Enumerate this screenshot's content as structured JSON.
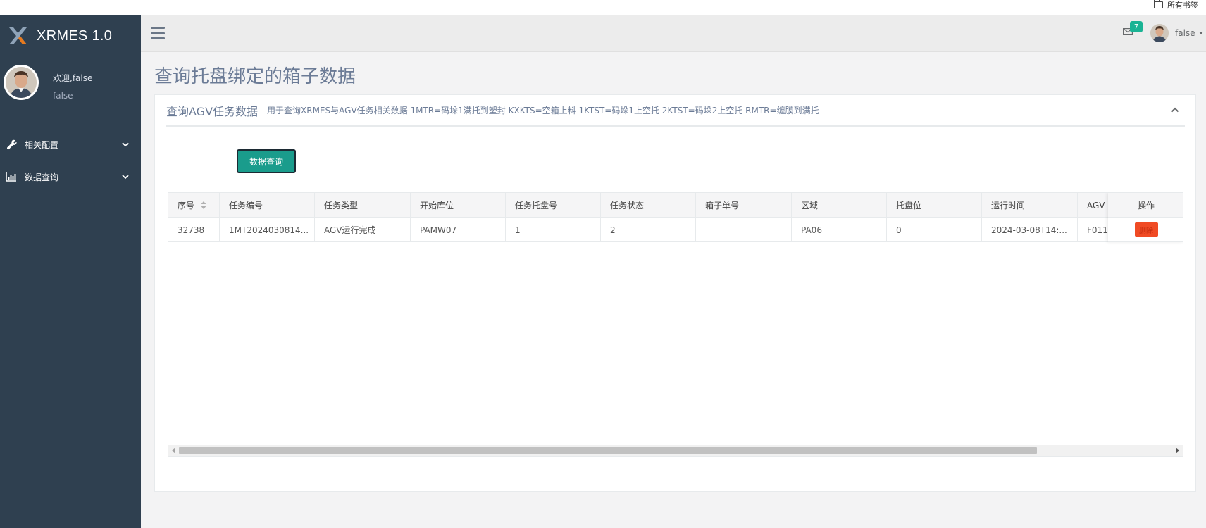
{
  "browser": {
    "bookmarks_all": "所有书签"
  },
  "brand": {
    "name": "XRMES 1.0"
  },
  "profile": {
    "welcome": "欢迎,false",
    "role": "false"
  },
  "sidebar": {
    "items": [
      {
        "label": "相关配置",
        "icon": "wrench-icon"
      },
      {
        "label": "数据查询",
        "icon": "bar-chart-icon"
      }
    ]
  },
  "topbar": {
    "mail_count": "7",
    "user_name": "false"
  },
  "page": {
    "title": "查询托盘绑定的箱子数据"
  },
  "panel": {
    "title": "查询AGV任务数据",
    "description": "用于查询XRMES与AGV任务相关数据 1MTR=码垛1满托到塑封 KXKTS=空箱上料 1KTST=码垛1上空托 2KTST=码垛2上空托 RMTR=缠膜到满托",
    "query_button": "数据查询"
  },
  "table": {
    "columns": [
      "序号",
      "任务编号",
      "任务类型",
      "开始库位",
      "任务托盘号",
      "任务状态",
      "箱子单号",
      "区域",
      "托盘位",
      "运行时间",
      "AGV"
    ],
    "rows": [
      [
        "32738",
        "1MT2024030814...",
        "AGV运行完成",
        "PAMW07",
        "1",
        "2",
        "",
        "PA06",
        "0",
        "2024-03-08T14:...",
        "F011"
      ]
    ],
    "action_header": "操作",
    "delete_label": "删除"
  },
  "colors": {
    "sidebar": "#2f4050",
    "primary": "#1a9c8c",
    "danger": "#f04b24",
    "badge": "#1ab394"
  }
}
